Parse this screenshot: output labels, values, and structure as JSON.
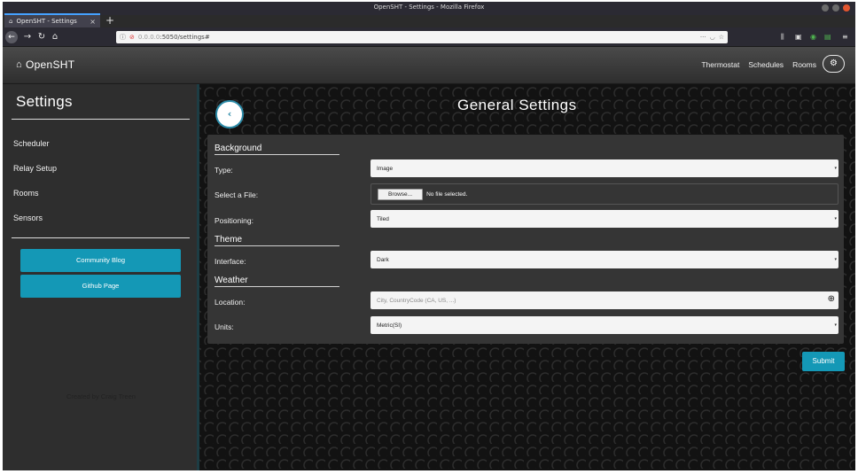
{
  "browser": {
    "window_title": "OpenSHT - Settings - Mozilla Firefox",
    "tab_title": "OpenSHT - Settings",
    "url_host": "0.0.0.0",
    "url_rest": ":5050/settings#"
  },
  "app": {
    "brand": "OpenSHT",
    "nav": [
      "Thermostat",
      "Schedules",
      "Rooms"
    ]
  },
  "sidebar": {
    "title": "Settings",
    "items": [
      "Scheduler",
      "Relay Setup",
      "Rooms",
      "Sensors"
    ],
    "buttons": [
      "Community Blog",
      "Github Page"
    ],
    "credit": "Created by Craig Treen"
  },
  "main": {
    "title": "General Settings",
    "sections": {
      "background": "Background",
      "theme": "Theme",
      "weather": "Weather"
    },
    "labels": {
      "type": "Type:",
      "file": "Select a File:",
      "positioning": "Positioning:",
      "interface": "Interface:",
      "location": "Location:",
      "units": "Units:"
    },
    "values": {
      "type": "Image",
      "positioning": "Tiled",
      "interface": "Dark",
      "units": "Metric(SI)"
    },
    "file_button": "Browse...",
    "file_status": "No file selected.",
    "location_placeholder": "City, CountryCode (CA, US, ...)",
    "submit": "Submit"
  }
}
